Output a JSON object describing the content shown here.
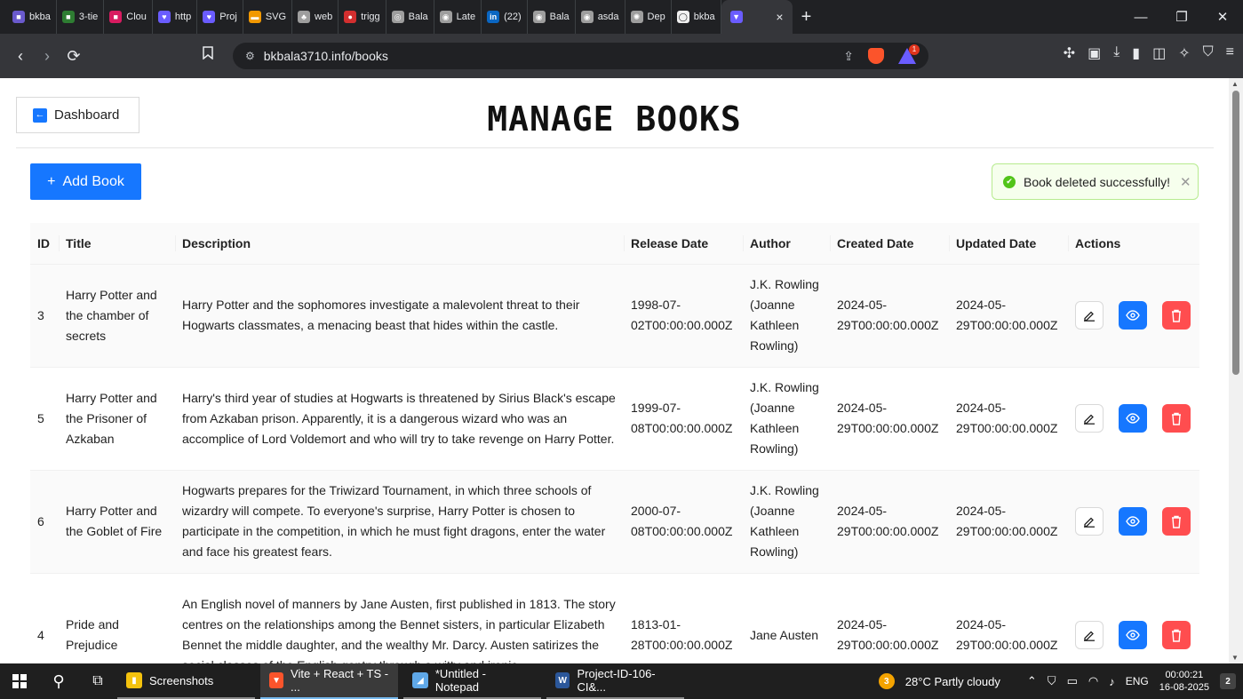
{
  "browser": {
    "tabs": [
      {
        "label": "bkba",
        "color": "#6a5acd",
        "glyph": "■"
      },
      {
        "label": "3-tie",
        "color": "#2e7d32",
        "glyph": "■"
      },
      {
        "label": "Clou",
        "color": "#d81b60",
        "glyph": "■"
      },
      {
        "label": "http",
        "color": "#6a5cff",
        "glyph": "♥"
      },
      {
        "label": "Proj",
        "color": "#6a5cff",
        "glyph": "♥"
      },
      {
        "label": "SVG",
        "color": "#f29900",
        "glyph": "▬"
      },
      {
        "label": "web",
        "color": "#9e9e9e",
        "glyph": "♣"
      },
      {
        "label": "trigg",
        "color": "#d32f2f",
        "glyph": "●"
      },
      {
        "label": "Bala",
        "color": "#9e9e9e",
        "glyph": "◎"
      },
      {
        "label": "Late",
        "color": "#9e9e9e",
        "glyph": "◉"
      },
      {
        "label": "(22)",
        "color": "#0a66c2",
        "glyph": "in"
      },
      {
        "label": "Bala",
        "color": "#9e9e9e",
        "glyph": "◉"
      },
      {
        "label": "asda",
        "color": "#9e9e9e",
        "glyph": "◉"
      },
      {
        "label": "Dep",
        "color": "#9e9e9e",
        "glyph": "✺"
      },
      {
        "label": "bkba",
        "color": "#f1f1f1",
        "glyph": "◯"
      }
    ],
    "active_tab_glyph": "▼",
    "active_tab_close": "×",
    "new_tab": "+",
    "window_controls": [
      "—",
      "❐",
      "✕"
    ],
    "url": "bkbala3710.info/books",
    "rewards_badge": "1",
    "toolbar_icons": [
      "extensions-icon",
      "screenshot-icon",
      "download-icon",
      "sidebar-icon",
      "wallet-icon",
      "leo-icon",
      "vpn-icon",
      "menu-icon"
    ]
  },
  "page": {
    "dashboard_label": "Dashboard",
    "title": "MANAGE BOOKS",
    "add_book_label": "Add Book",
    "toast_message": "Book deleted successfully!",
    "columns": [
      "ID",
      "Title",
      "Description",
      "Release Date",
      "Author",
      "Created Date",
      "Updated Date",
      "Actions"
    ],
    "rows": [
      {
        "id": "3",
        "title": "Harry Potter and the chamber of secrets",
        "description": "Harry Potter and the sophomores investigate a malevolent threat to their Hogwarts classmates, a menacing beast that hides within the castle.",
        "release_date": "1998-07-02T00:00:00.000Z",
        "author": "J.K. Rowling (Joanne Kathleen Rowling)",
        "created_date": "2024-05-29T00:00:00.000Z",
        "updated_date": "2024-05-29T00:00:00.000Z"
      },
      {
        "id": "5",
        "title": "Harry Potter and the Prisoner of Azkaban",
        "description": "Harry's third year of studies at Hogwarts is threatened by Sirius Black's escape from Azkaban prison. Apparently, it is a dangerous wizard who was an accomplice of Lord Voldemort and who will try to take revenge on Harry Potter.",
        "release_date": "1999-07-08T00:00:00.000Z",
        "author": "J.K. Rowling (Joanne Kathleen Rowling)",
        "created_date": "2024-05-29T00:00:00.000Z",
        "updated_date": "2024-05-29T00:00:00.000Z"
      },
      {
        "id": "6",
        "title": "Harry Potter and the Goblet of Fire",
        "description": "Hogwarts prepares for the Triwizard Tournament, in which three schools of wizardry will compete. To everyone's surprise, Harry Potter is chosen to participate in the competition, in which he must fight dragons, enter the water and face his greatest fears.",
        "release_date": "2000-07-08T00:00:00.000Z",
        "author": "J.K. Rowling (Joanne Kathleen Rowling)",
        "created_date": "2024-05-29T00:00:00.000Z",
        "updated_date": "2024-05-29T00:00:00.000Z"
      },
      {
        "id": "4",
        "title": "Pride and Prejudice",
        "description": "An English novel of manners by Jane Austen, first published in 1813. The story centres on the relationships among the Bennet sisters, in particular Elizabeth Bennet the middle daughter, and the wealthy Mr. Darcy. Austen satirizes the social classes of the English gentry through a witty and ironic",
        "release_date": "1813-01-28T00:00:00.000Z",
        "author": "Jane Austen",
        "created_date": "2024-05-29T00:00:00.000Z",
        "updated_date": "2024-05-29T00:00:00.000Z"
      }
    ]
  },
  "taskbar": {
    "apps": [
      {
        "label": "Screenshots",
        "color": "#f4c20d",
        "glyph": "▮",
        "active": false
      },
      {
        "label": "Vite + React + TS - ...",
        "color": "#fb542b",
        "glyph": "▼",
        "active": true
      },
      {
        "label": "*Untitled - Notepad",
        "color": "#5fa8e8",
        "glyph": "◢",
        "active": false
      },
      {
        "label": "Project-ID-106-CI&...",
        "color": "#2b579a",
        "glyph": "W",
        "active": false
      }
    ],
    "weather": "28°C  Partly cloudy",
    "weather_badge": "3",
    "language": "ENG",
    "time": "00:00:21",
    "date": "16-08-2025",
    "notification_count": "2"
  },
  "colors": {
    "primary": "#1677ff",
    "danger": "#ff4d4f",
    "success": "#52c41a"
  }
}
